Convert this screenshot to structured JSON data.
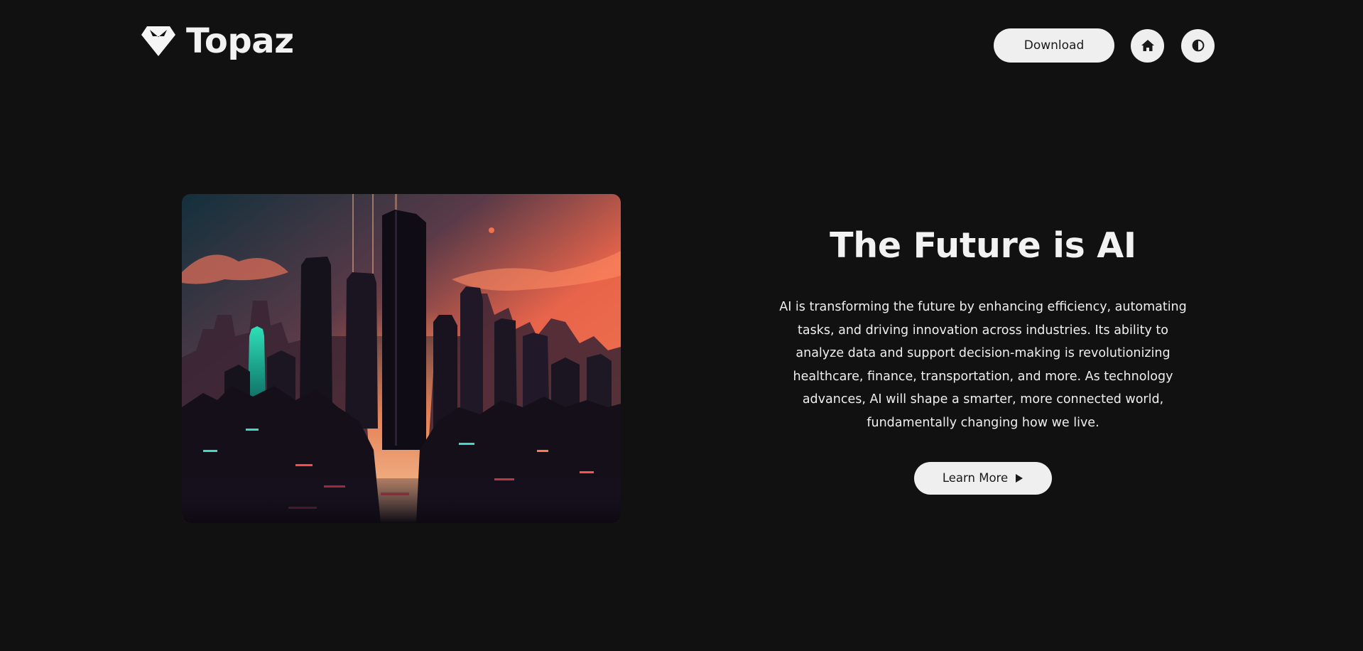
{
  "header": {
    "brand_name": "Topaz",
    "logo_icon": "diamond-icon",
    "download_label": "Download",
    "home_icon": "home-icon",
    "theme_icon": "contrast-icon"
  },
  "hero": {
    "image_icon": "futuristic-city-image",
    "title": "The Future is AI",
    "description": "AI is transforming the future by enhancing efficiency, automating tasks, and driving innovation across industries. Its ability to analyze data and support decision-making is revolutionizing healthcare, finance, transportation, and more. As technology advances, AI will shape a smarter, more connected world, fundamentally changing how we live.",
    "cta_label": "Learn More",
    "cta_icon": "play-icon"
  },
  "colors": {
    "background": "#111111",
    "button": "#efefef",
    "text": "#f2f2f2"
  }
}
